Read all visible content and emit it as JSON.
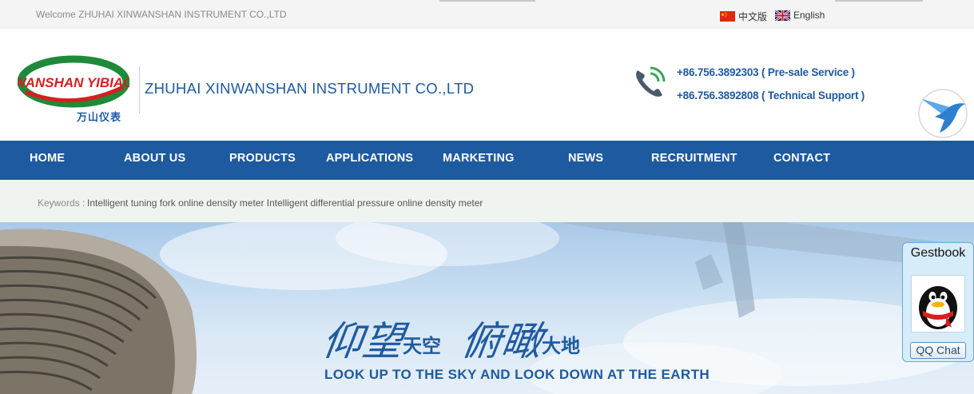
{
  "topbar": {
    "welcome": "Welcome ZHUHAI XINWANSHAN INSTRUMENT CO.,LTD",
    "languages": [
      {
        "label": "中文版",
        "icon": "china-flag-icon"
      },
      {
        "label": "English",
        "icon": "uk-flag-icon"
      }
    ]
  },
  "header": {
    "logo_text": "WANSHAN YIBIAO",
    "logo_cn": "万山仪表",
    "company_name": "ZHUHAI XINWANSHAN INSTRUMENT CO.,LTD",
    "phones": [
      "+86.756.3892303 ( Pre-sale Service )",
      "+86.756.3892808 ( Technical Support )"
    ]
  },
  "nav": {
    "items": [
      "HOME",
      "ABOUT US",
      "PRODUCTS",
      "APPLICATIONS",
      "MARKETING",
      "NEWS",
      "RECRUITMENT",
      "CONTACT"
    ]
  },
  "keywords": {
    "label": "Keywords :",
    "text": "Intelligent tuning fork online density meter Intelligent differential pressure online density meter"
  },
  "banner": {
    "slogan_cn_1a": "仰望",
    "slogan_cn_1b": "天空",
    "slogan_cn_2a": "俯瞰",
    "slogan_cn_2b": "大地",
    "slogan_en": "LOOK UP TO THE SKY AND LOOK DOWN AT THE EARTH"
  },
  "qq_widget": {
    "title": "Gestbook",
    "button": "QQ Chat"
  },
  "colors": {
    "brand_blue": "#1e5aa0",
    "logo_green": "#1e8a3a",
    "logo_red": "#d42020"
  }
}
